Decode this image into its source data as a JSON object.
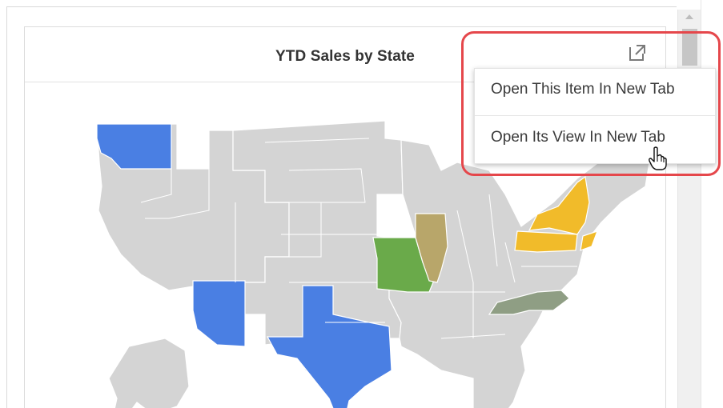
{
  "panel": {
    "title": "YTD Sales by State"
  },
  "toolbar": {
    "open_icon": "open-in-new-icon"
  },
  "context_menu": {
    "items": [
      {
        "label": "Open This Item In New Tab"
      },
      {
        "label": "Open Its View In New Tab"
      }
    ]
  },
  "map": {
    "base_color": "#d4d4d4",
    "border_color": "#ffffff",
    "highlighted_states": [
      {
        "state": "Washington",
        "color": "#4a7fe3"
      },
      {
        "state": "Arizona",
        "color": "#4a7fe3"
      },
      {
        "state": "Texas",
        "color": "#4a7fe3"
      },
      {
        "state": "Missouri",
        "color": "#6aaa4a"
      },
      {
        "state": "Illinois",
        "color": "#b8a66a"
      },
      {
        "state": "New York",
        "color": "#f1bb2a"
      },
      {
        "state": "Pennsylvania",
        "color": "#f1bb2a"
      },
      {
        "state": "North Carolina",
        "color": "#8f9e84"
      }
    ]
  },
  "colors": {
    "highlight_border": "#e5474b",
    "accent_blue": "#4a7fe3",
    "accent_green": "#6aaa4a",
    "accent_tan": "#b8a66a",
    "accent_yellow": "#f1bb2a",
    "accent_grayish": "#8f9e84"
  }
}
